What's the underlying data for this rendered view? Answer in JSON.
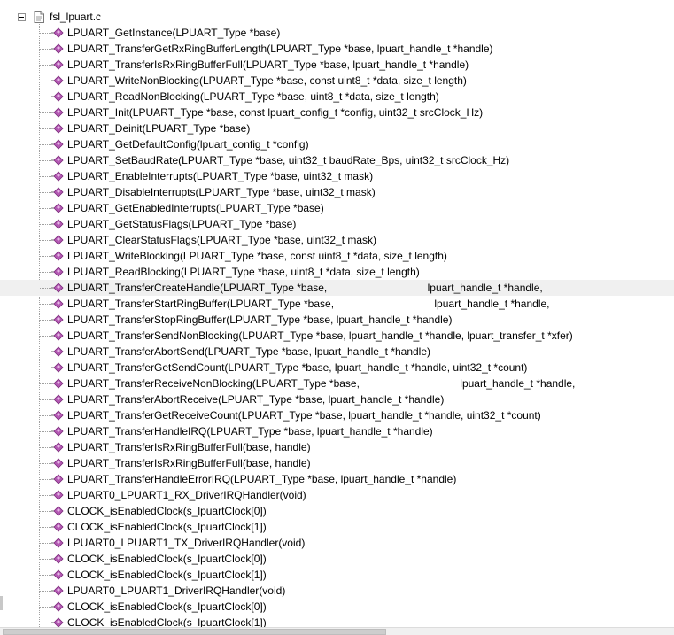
{
  "tree": {
    "root": {
      "label": "fsl_lpuart.c",
      "icon": "c-file-icon"
    },
    "items": [
      "LPUART_GetInstance(LPUART_Type *base)",
      "LPUART_TransferGetRxRingBufferLength(LPUART_Type *base, lpuart_handle_t *handle)",
      "LPUART_TransferIsRxRingBufferFull(LPUART_Type *base, lpuart_handle_t *handle)",
      "LPUART_WriteNonBlocking(LPUART_Type *base, const uint8_t *data, size_t length)",
      "LPUART_ReadNonBlocking(LPUART_Type *base, uint8_t *data, size_t length)",
      "LPUART_Init(LPUART_Type *base, const lpuart_config_t *config, uint32_t srcClock_Hz)",
      "LPUART_Deinit(LPUART_Type *base)",
      "LPUART_GetDefaultConfig(lpuart_config_t *config)",
      "LPUART_SetBaudRate(LPUART_Type *base, uint32_t baudRate_Bps, uint32_t srcClock_Hz)",
      "LPUART_EnableInterrupts(LPUART_Type *base, uint32_t mask)",
      "LPUART_DisableInterrupts(LPUART_Type *base, uint32_t mask)",
      "LPUART_GetEnabledInterrupts(LPUART_Type *base)",
      "LPUART_GetStatusFlags(LPUART_Type *base)",
      "LPUART_ClearStatusFlags(LPUART_Type *base, uint32_t mask)",
      "LPUART_WriteBlocking(LPUART_Type *base, const uint8_t *data, size_t length)",
      "LPUART_ReadBlocking(LPUART_Type *base, uint8_t *data, size_t length)",
      "LPUART_TransferCreateHandle(LPUART_Type *base,                                  lpuart_handle_t *handle,",
      "LPUART_TransferStartRingBuffer(LPUART_Type *base,                                  lpuart_handle_t *handle,",
      "LPUART_TransferStopRingBuffer(LPUART_Type *base, lpuart_handle_t *handle)",
      "LPUART_TransferSendNonBlocking(LPUART_Type *base, lpuart_handle_t *handle, lpuart_transfer_t *xfer)",
      "LPUART_TransferAbortSend(LPUART_Type *base, lpuart_handle_t *handle)",
      "LPUART_TransferGetSendCount(LPUART_Type *base, lpuart_handle_t *handle, uint32_t *count)",
      "LPUART_TransferReceiveNonBlocking(LPUART_Type *base,                                  lpuart_handle_t *handle,",
      "LPUART_TransferAbortReceive(LPUART_Type *base, lpuart_handle_t *handle)",
      "LPUART_TransferGetReceiveCount(LPUART_Type *base, lpuart_handle_t *handle, uint32_t *count)",
      "LPUART_TransferHandleIRQ(LPUART_Type *base, lpuart_handle_t *handle)",
      "LPUART_TransferIsRxRingBufferFull(base, handle)",
      "LPUART_TransferIsRxRingBufferFull(base, handle)",
      "LPUART_TransferHandleErrorIRQ(LPUART_Type *base, lpuart_handle_t *handle)",
      "LPUART0_LPUART1_RX_DriverIRQHandler(void)",
      "CLOCK_isEnabledClock(s_lpuartClock[0])",
      "CLOCK_isEnabledClock(s_lpuartClock[1])",
      "LPUART0_LPUART1_TX_DriverIRQHandler(void)",
      "CLOCK_isEnabledClock(s_lpuartClock[0])",
      "CLOCK_isEnabledClock(s_lpuartClock[1])",
      "LPUART0_LPUART1_DriverIRQHandler(void)",
      "CLOCK_isEnabledClock(s_lpuartClock[0])",
      "CLOCK_isEnabledClock(s_lpuartClock[1])"
    ],
    "item_icon": "function-icon",
    "highlighted_index": 16
  },
  "colors": {
    "function_icon": "#b45ab4",
    "highlight": "#f0f0f0",
    "tree_lines": "#a0a0a0"
  }
}
